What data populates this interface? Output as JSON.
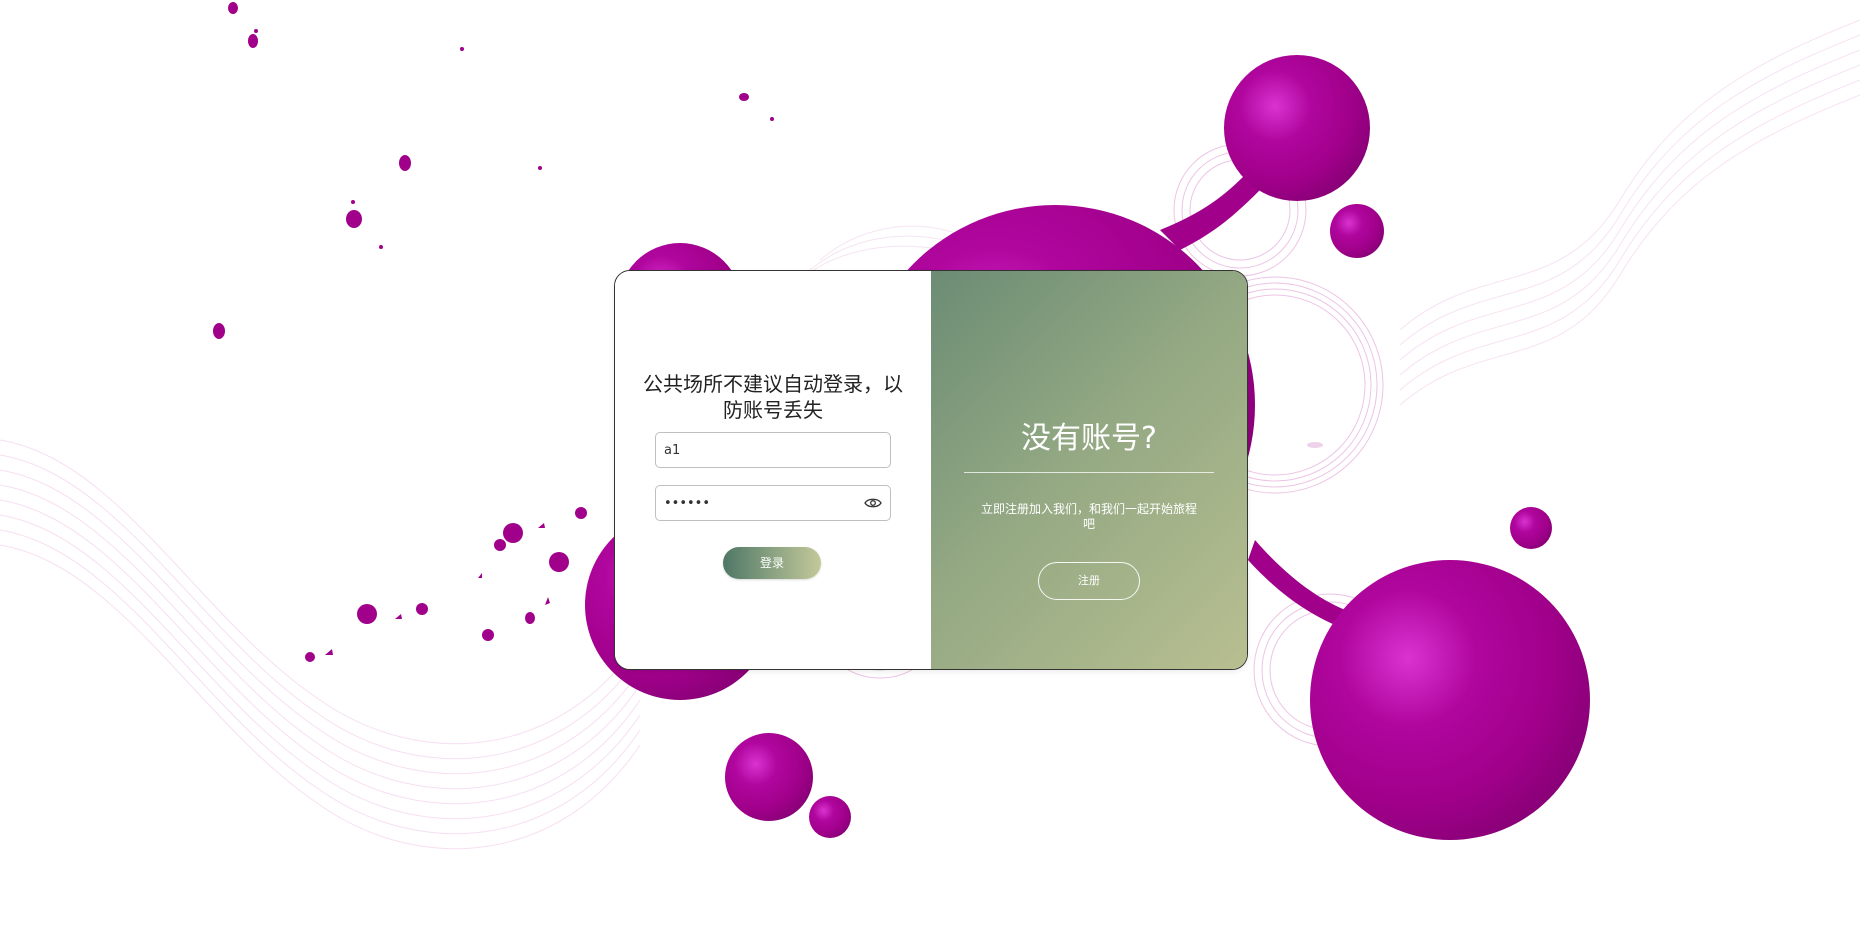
{
  "colors": {
    "accent_magenta": "#a0008a",
    "panel_gradient_start": "#6b8c74",
    "panel_gradient_end": "#b8bf91"
  },
  "login": {
    "notice": "公共场所不建议自动登录，以防账号丢失",
    "username_value": "a1",
    "password_value": "••••••",
    "password_toggle_icon": "eye-icon",
    "login_label": "登录"
  },
  "register_panel": {
    "title": "没有账号?",
    "description": "立即注册加入我们，和我们一起开始旅程吧",
    "register_label": "注册"
  }
}
